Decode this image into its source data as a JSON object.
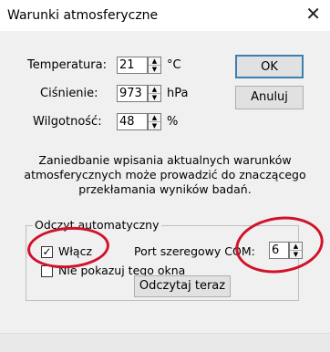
{
  "window": {
    "title": "Warunki atmosferyczne",
    "close_glyph": "✕"
  },
  "fields": [
    {
      "label": "Temperatura:",
      "value": "21",
      "unit": "°C"
    },
    {
      "label": "Ciśnienie:",
      "value": "973",
      "unit": "hPa"
    },
    {
      "label": "Wilgotność:",
      "value": "48",
      "unit": "%"
    }
  ],
  "buttons": {
    "ok": "OK",
    "cancel": "Anuluj",
    "read_now": "Odczytaj teraz"
  },
  "message": "Zaniedbanie wpisania aktualnych warunków atmosferycznych może prowadzić do znaczącego przekłamania wyników badań.",
  "auto_read": {
    "group_label": "Odczyt automatyczny",
    "enable_label": "Włącz",
    "enable_checked": true,
    "check_glyph": "✓",
    "port_label": "Port szeregowy COM:",
    "port_value": "6",
    "hide_label": "Nie pokazuj tego okna",
    "hide_checked": false
  },
  "annotation_color": "#d0122a"
}
